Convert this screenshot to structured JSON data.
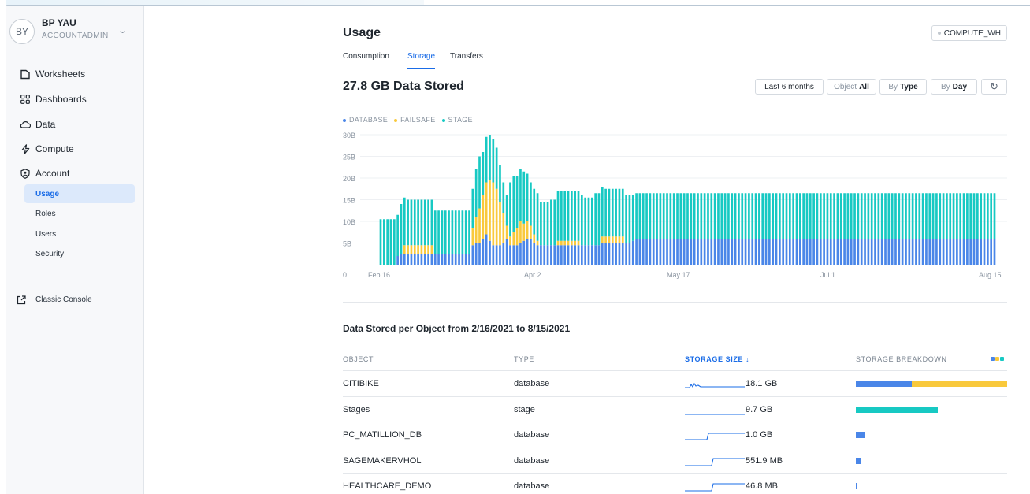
{
  "user": {
    "initials": "BY",
    "name": "BP YAU",
    "role": "ACCOUNTADMIN"
  },
  "nav": {
    "items": [
      {
        "label": "Worksheets",
        "icon": "worksheet-icon"
      },
      {
        "label": "Dashboards",
        "icon": "dashboard-icon"
      },
      {
        "label": "Data",
        "icon": "cloud-icon"
      },
      {
        "label": "Compute",
        "icon": "bolt-icon"
      },
      {
        "label": "Account",
        "icon": "account-shield-icon"
      }
    ],
    "sub": [
      {
        "label": "Usage",
        "active": true
      },
      {
        "label": "Roles",
        "active": false
      },
      {
        "label": "Users",
        "active": false
      },
      {
        "label": "Security",
        "active": false
      }
    ],
    "classic": "Classic Console"
  },
  "page": {
    "title": "Usage",
    "warehouse": "COMPUTE_WH",
    "tabs": [
      "Consumption",
      "Storage",
      "Transfers"
    ],
    "active_tab": "Storage",
    "stored": "27.8 GB Data Stored"
  },
  "controls": {
    "range": "Last 6 months",
    "object_label": "Object",
    "object_value": "All",
    "by_label": "By",
    "by_value": "Type",
    "by2_label": "By",
    "by2_value": "Day",
    "refresh_glyph": "↻"
  },
  "colors": {
    "database": "#4a86e8",
    "failsafe": "#f9c93c",
    "stage": "#17c9c3",
    "accent": "#1a6ce7"
  },
  "chart_data": {
    "type": "bar",
    "stacked": true,
    "legend": [
      "DATABASE",
      "FAILSAFE",
      "STAGE"
    ],
    "legend_position": "top-left",
    "x_ticks": [
      "Feb 16",
      "Apr 2",
      "May 17",
      "Jul 1",
      "Aug 15"
    ],
    "y_ticks": [
      "0",
      "5B",
      "10B",
      "15B",
      "20B",
      "25B",
      "30B"
    ],
    "ylim": [
      0,
      30
    ],
    "grid": true,
    "segments": [
      {
        "from": 0,
        "to": 4,
        "database": 0,
        "failsafe": 0,
        "stage": 10.5
      },
      {
        "from": 5,
        "to": 5,
        "database": 2,
        "failsafe": 0,
        "stage": 9.5
      },
      {
        "from": 6,
        "to": 6,
        "database": 2.5,
        "failsafe": 0,
        "stage": 11.5
      },
      {
        "from": 7,
        "to": 7,
        "database": 2.5,
        "failsafe": 2,
        "stage": 11
      },
      {
        "from": 8,
        "to": 15,
        "database": 2.5,
        "failsafe": 2,
        "stage": 10.5
      },
      {
        "from": 16,
        "to": 16,
        "database": 2.5,
        "failsafe": 0,
        "stage": 10
      },
      {
        "from": 17,
        "to": 26,
        "database": 2.5,
        "failsafe": 0,
        "stage": 10
      },
      {
        "from": 27,
        "to": 27,
        "database": 4.5,
        "failsafe": 4,
        "stage": 9
      },
      {
        "from": 28,
        "to": 28,
        "database": 5,
        "failsafe": 6,
        "stage": 11
      },
      {
        "from": 29,
        "to": 29,
        "database": 5,
        "failsafe": 8,
        "stage": 12
      },
      {
        "from": 30,
        "to": 30,
        "database": 6,
        "failsafe": 10,
        "stage": 10
      },
      {
        "from": 31,
        "to": 31,
        "database": 7,
        "failsafe": 12,
        "stage": 10.5
      },
      {
        "from": 32,
        "to": 32,
        "database": 5.5,
        "failsafe": 14,
        "stage": 10.5
      },
      {
        "from": 33,
        "to": 33,
        "database": 4.5,
        "failsafe": 14.5,
        "stage": 10
      },
      {
        "from": 34,
        "to": 34,
        "database": 4.5,
        "failsafe": 13,
        "stage": 9.5
      },
      {
        "from": 35,
        "to": 35,
        "database": 4.5,
        "failsafe": 10,
        "stage": 8.5
      },
      {
        "from": 36,
        "to": 36,
        "database": 5,
        "failsafe": 7,
        "stage": 7
      },
      {
        "from": 37,
        "to": 37,
        "database": 6,
        "failsafe": 3,
        "stage": 7
      },
      {
        "from": 38,
        "to": 38,
        "database": 4.5,
        "failsafe": 2,
        "stage": 12.5
      },
      {
        "from": 39,
        "to": 39,
        "database": 4.5,
        "failsafe": 3,
        "stage": 13
      },
      {
        "from": 40,
        "to": 40,
        "database": 4.5,
        "failsafe": 4,
        "stage": 12
      },
      {
        "from": 41,
        "to": 41,
        "database": 5,
        "failsafe": 5,
        "stage": 12
      },
      {
        "from": 42,
        "to": 42,
        "database": 5.5,
        "failsafe": 4,
        "stage": 12
      },
      {
        "from": 43,
        "to": 43,
        "database": 6,
        "failsafe": 4,
        "stage": 11
      },
      {
        "from": 44,
        "to": 44,
        "database": 6,
        "failsafe": 3,
        "stage": 10
      },
      {
        "from": 45,
        "to": 45,
        "database": 5,
        "failsafe": 2,
        "stage": 10.5
      },
      {
        "from": 46,
        "to": 46,
        "database": 4.5,
        "failsafe": 1,
        "stage": 11
      },
      {
        "from": 47,
        "to": 49,
        "database": 4.5,
        "failsafe": 0,
        "stage": 10
      },
      {
        "from": 50,
        "to": 51,
        "database": 4.5,
        "failsafe": 0,
        "stage": 10.5
      },
      {
        "from": 52,
        "to": 58,
        "database": 4.5,
        "failsafe": 1,
        "stage": 11.5
      },
      {
        "from": 59,
        "to": 59,
        "database": 4.5,
        "failsafe": 0,
        "stage": 11.5
      },
      {
        "from": 60,
        "to": 62,
        "database": 4.5,
        "failsafe": 0,
        "stage": 11
      },
      {
        "from": 63,
        "to": 64,
        "database": 4.5,
        "failsafe": 0,
        "stage": 12
      },
      {
        "from": 65,
        "to": 65,
        "database": 5,
        "failsafe": 1.5,
        "stage": 11.5
      },
      {
        "from": 66,
        "to": 71,
        "database": 5,
        "failsafe": 1.5,
        "stage": 11
      },
      {
        "from": 72,
        "to": 72,
        "database": 5,
        "failsafe": 0,
        "stage": 11
      },
      {
        "from": 73,
        "to": 73,
        "database": 5,
        "failsafe": 0,
        "stage": 11
      },
      {
        "from": 74,
        "to": 74,
        "database": 5.5,
        "failsafe": 0,
        "stage": 10.5
      },
      {
        "from": 75,
        "to": 180,
        "database": 6,
        "failsafe": 0,
        "stage": 10.5
      }
    ]
  },
  "table": {
    "title": "Data Stored per Object from 2/16/2021 to 8/15/2021",
    "headers": {
      "object": "OBJECT",
      "type": "TYPE",
      "size": "STORAGE SIZE ↓",
      "breakdown": "STORAGE BREAKDOWN"
    },
    "rows": [
      {
        "object": "CITIBIKE",
        "type": "database",
        "size": "18.1 GB",
        "spark": "citibike",
        "breakdown": {
          "database": 0.37,
          "failsafe": 0.63,
          "stage": 0
        }
      },
      {
        "object": "Stages",
        "type": "stage",
        "size": "9.7 GB",
        "spark": "flat",
        "breakdown": {
          "database": 0,
          "failsafe": 0,
          "stage": 0.54
        }
      },
      {
        "object": "PC_MATILLION_DB",
        "type": "database",
        "size": "1.0 GB",
        "spark": "step1",
        "breakdown": {
          "database": 0.055,
          "failsafe": 0,
          "stage": 0
        }
      },
      {
        "object": "SAGEMAKERVHOL",
        "type": "database",
        "size": "551.9 MB",
        "spark": "step2",
        "breakdown": {
          "database": 0.03,
          "failsafe": 0,
          "stage": 0
        }
      },
      {
        "object": "HEALTHCARE_DEMO",
        "type": "database",
        "size": "46.8 MB",
        "spark": "step2",
        "breakdown": {
          "database": 0.005,
          "failsafe": 0,
          "stage": 0
        }
      }
    ]
  }
}
